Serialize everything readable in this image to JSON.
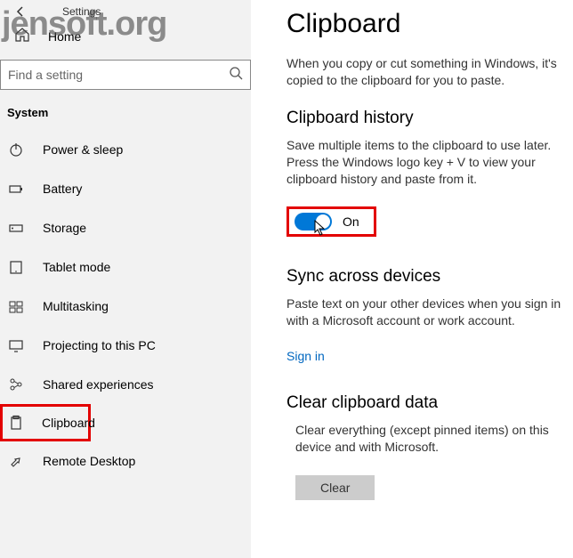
{
  "watermark": "jensoft.org",
  "header": {
    "settings": "Settings",
    "home": "Home"
  },
  "search": {
    "placeholder": "Find a setting"
  },
  "group": {
    "title": "System"
  },
  "nav": {
    "power": "Power & sleep",
    "battery": "Battery",
    "storage": "Storage",
    "tablet": "Tablet mode",
    "multitasking": "Multitasking",
    "projecting": "Projecting to this PC",
    "shared": "Shared experiences",
    "clipboard": "Clipboard",
    "remote": "Remote Desktop"
  },
  "main": {
    "title": "Clipboard",
    "intro": "When you copy or cut something in Windows, it's copied to the clipboard for you to paste.",
    "history": {
      "title": "Clipboard history",
      "desc": "Save multiple items to the clipboard to use later. Press the Windows logo key + V to view your clipboard history and paste from it.",
      "toggle_state": "On"
    },
    "sync": {
      "title": "Sync across devices",
      "desc": "Paste text on your other devices when you sign in with a Microsoft account or work account.",
      "link": "Sign in"
    },
    "clear": {
      "title": "Clear clipboard data",
      "desc": "Clear everything (except pinned items) on this device and with Microsoft.",
      "button": "Clear"
    }
  }
}
